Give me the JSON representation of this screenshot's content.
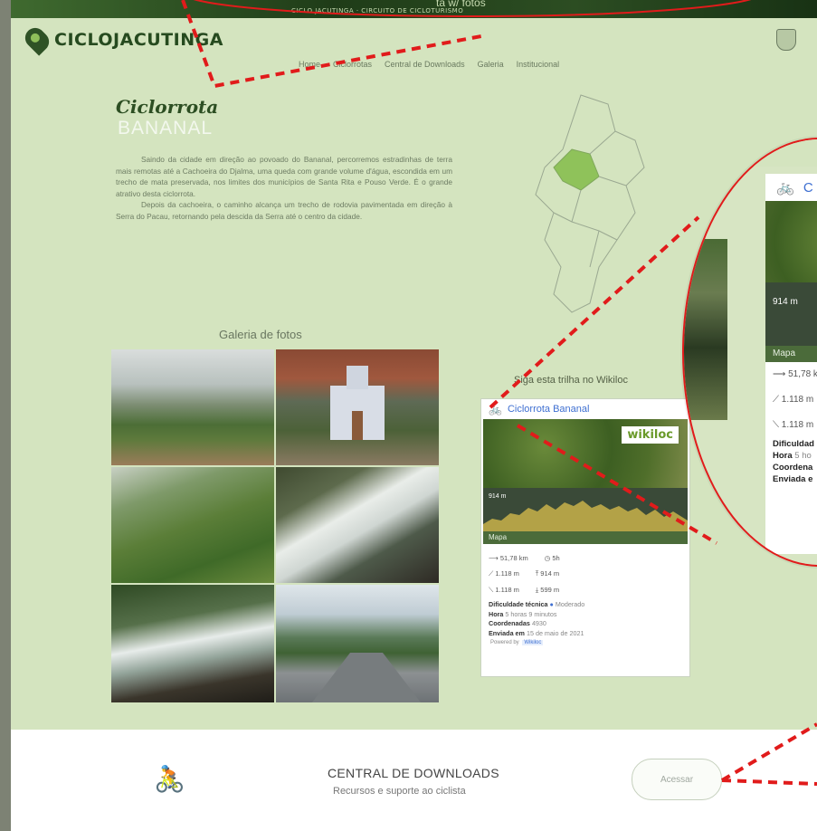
{
  "top": {
    "title": "ta w/ fotos",
    "subtitle": "CICLO JACUTINGA · CIRCUITO DE CICLOTURISMO"
  },
  "brand": {
    "logo_text": "CICLOJACUTINGA"
  },
  "nav": {
    "items": [
      "Home",
      "Ciclorrotas",
      "Central de Downloads",
      "Galeria",
      "Institucional"
    ]
  },
  "route": {
    "title": "Ciclorrota",
    "subtitle": "BANANAL",
    "paragraph1": "Saindo da cidade em direção ao povoado do Bananal, percorremos estradinhas de terra mais remotas até a Cachoeira do Djalma, uma queda com grande volume d'água, escondida em um trecho de mata preservada, nos limites dos municípios de Santa Rita e Pouso Verde. É o grande atrativo desta ciclorrota.",
    "paragraph2": "Depois da cachoeira, o caminho alcança um trecho de rodovia pavimentada em direção à Serra do Pacau, retornando pela descida da Serra até o centro da cidade."
  },
  "gallery": {
    "title": "Galeria de fotos"
  },
  "wikiloc": {
    "heading": "Siga esta trilha no Wikiloc",
    "trail_name": "Ciclorrota Bananal",
    "logo": "wikiloc",
    "alt_label": "914 m",
    "bar_label": "Mapa",
    "distance": "51,78 km",
    "time": "5h",
    "ascent": "1.118 m",
    "max_alt": "914 m",
    "descent": "1.118 m",
    "min_alt": "599 m",
    "difficulty_label": "Dificuldade técnica",
    "difficulty_value": "Moderado",
    "hora_label": "Hora",
    "hora_value": "5 horas 9 minutos",
    "coords_label": "Coordenadas",
    "coords_value": "4930",
    "sent_label": "Enviada em",
    "sent_value": "15 de maio de 2021",
    "powered_prefix": "Powered by",
    "powered_link": "Wikiloc"
  },
  "zoom": {
    "trail_initial": "C",
    "alt_label": "914 m",
    "bar_label": "Mapa",
    "distance": "51,78 k",
    "ascent": "1.118 m",
    "descent": "1.118 m",
    "difficulty": "Dificuldad",
    "hora": "Hora",
    "hora_value": "5 ho",
    "coords": "Coordena",
    "sent": "Enviada e"
  },
  "downloads": {
    "title": "CENTRAL DE DOWNLOADS",
    "subtitle": "Recursos e suporte ao ciclista",
    "button": "Acessar"
  },
  "colors": {
    "background": "#d4e4bf",
    "accent_red": "#e11b1b",
    "brand_green": "#264a1f",
    "link_blue": "#3e6fd1"
  }
}
